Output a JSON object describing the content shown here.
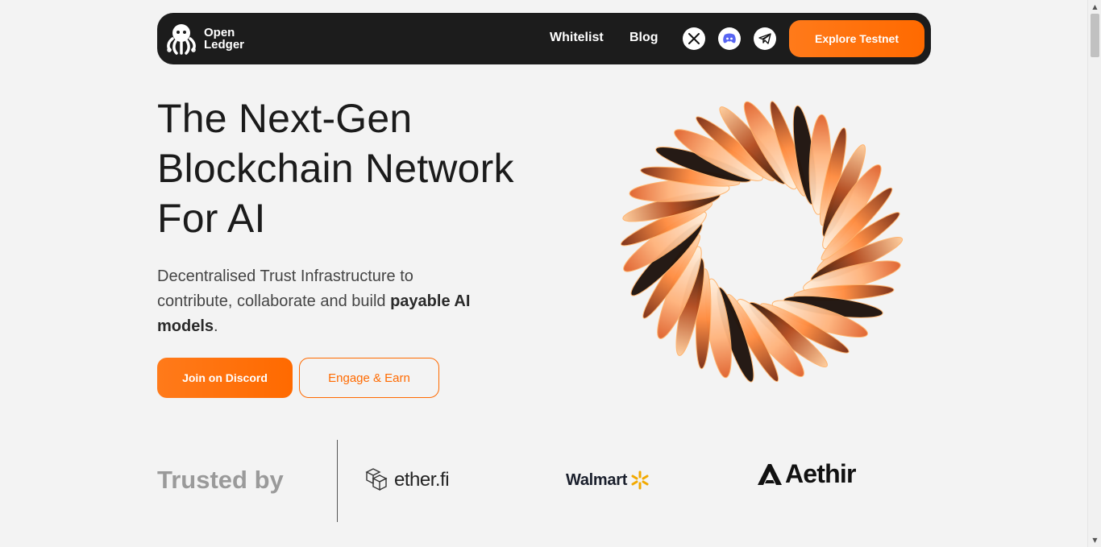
{
  "nav": {
    "brand_line1": "Open",
    "brand_line2": "Ledger",
    "links": [
      "Whitelist",
      "Blog"
    ],
    "socials": [
      "x-icon",
      "discord-icon",
      "telegram-icon"
    ],
    "cta": "Explore Testnet"
  },
  "hero": {
    "title_line1": "The Next-Gen",
    "title_line2": "Blockchain Network",
    "title_line3": "For AI",
    "subtitle_part1": "Decentralised Trust Infrastructure to contribute, collaborate and build ",
    "subtitle_bold": "payable AI models",
    "subtitle_end": ".",
    "primary_button": "Join on Discord",
    "secondary_button": "Engage & Earn"
  },
  "trusted": {
    "label": "Trusted by",
    "partners": [
      "ether.fi",
      "Walmart",
      "Aethir"
    ]
  },
  "colors": {
    "accent": "#ff6a00",
    "nav_bg": "#1c1c1c",
    "page_bg": "#f3f3f3"
  }
}
